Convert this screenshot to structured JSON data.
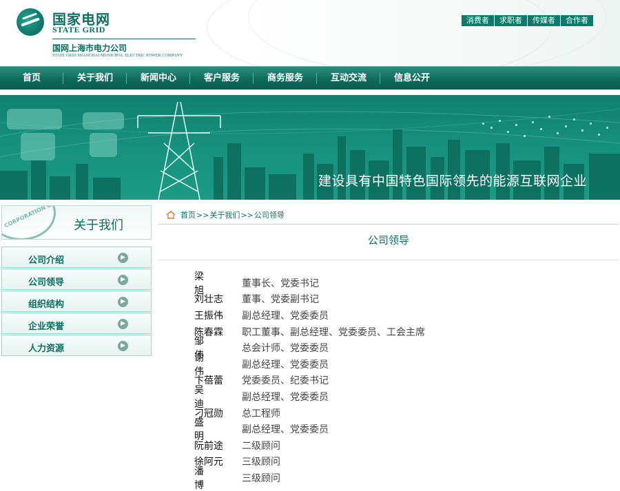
{
  "header": {
    "brand_cn": "国家电网",
    "brand_en": "STATE GRID",
    "company_cn": "国网上海市电力公司",
    "company_en": "STATE GRID SHANGHAI MUNICIPAL ELECTRIC POWER COMPANY",
    "user_links": [
      "消费者",
      "求职者",
      "传媒者",
      "合作者"
    ]
  },
  "nav": {
    "items": [
      "首页",
      "关于我们",
      "新闻中心",
      "客户服务",
      "商务服务",
      "互动交流",
      "信息公开"
    ]
  },
  "banner": {
    "slogan": "建设具有中国特色国际领先的能源互联网企业"
  },
  "sidebar": {
    "seal_text": "CORPORATION OF",
    "title": "关于我们",
    "items": [
      "公司介绍",
      "公司领导",
      "组织结构",
      "企业荣誉",
      "人力资源"
    ],
    "arrow_icon": "circle-arrow-right-icon"
  },
  "breadcrumb": {
    "home": "首页",
    "sep": ">>",
    "section": "关于我们",
    "current": "公司领导"
  },
  "main": {
    "title": "公司领导",
    "leaders": [
      {
        "name": "梁 旭",
        "title": "董事长、党委书记"
      },
      {
        "name": "刘壮志",
        "title": "董事、党委副书记"
      },
      {
        "name": "王振伟",
        "title": "副总经理、党委委员"
      },
      {
        "name": "陈春霖",
        "title": "职工董事、副总经理、党委委员、工会主席"
      },
      {
        "name": "邹 伟",
        "title": "总会计师、党委委员"
      },
      {
        "name": "谢 伟",
        "title": "副总经理、党委委员"
      },
      {
        "name": "卞蓓蕾",
        "title": "党委委员、纪委书记"
      },
      {
        "name": "吴 迪",
        "title": "副总经理、党委委员"
      },
      {
        "name": "刁冠勋",
        "title": "总工程师"
      },
      {
        "name": "盛 明",
        "title": "副总经理、党委委员"
      },
      {
        "name": "阮前途",
        "title": "二级顾问"
      },
      {
        "name": "徐阿元",
        "title": "三级顾问"
      },
      {
        "name": "潘 博",
        "title": "三级顾问"
      }
    ]
  },
  "colors": {
    "brand_green": "#0c6e61",
    "nav_green": "#0e6b5c",
    "banner_green": "#16907d"
  }
}
